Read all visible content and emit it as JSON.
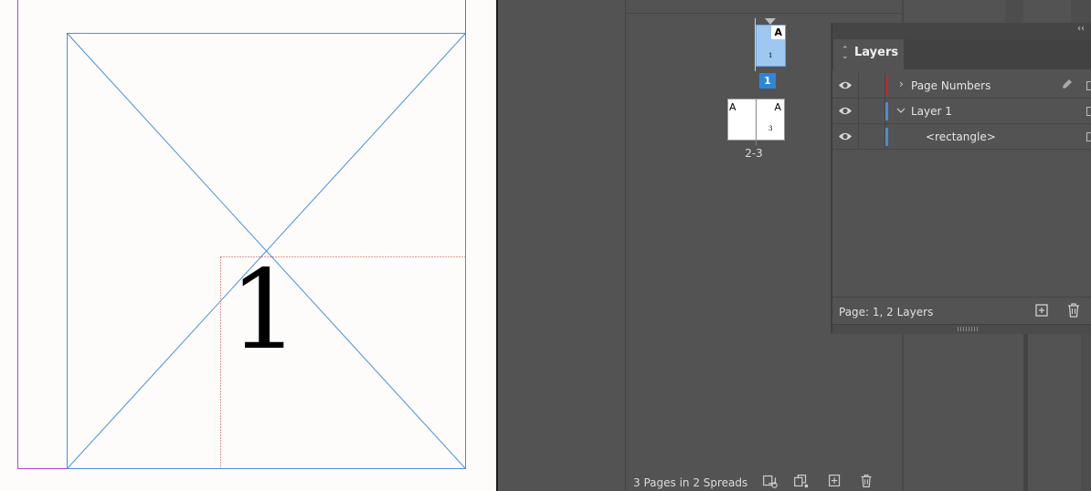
{
  "document": {
    "page_number_marker": "1"
  },
  "pages_panel": {
    "master_prefix": "A",
    "thumb_page_1": "1",
    "spread_1_label": "1",
    "spread_2_label": "2-3",
    "spread_2_left_prefix": "A",
    "spread_2_right_prefix": "A",
    "thumb_page_3": "3",
    "status_text": "3 Pages in 2 Spreads",
    "icons": [
      "edit-page-size-icon",
      "new-spread-icon",
      "create-new-page-icon",
      "delete-page-icon"
    ]
  },
  "layers_panel": {
    "collapse_glyph": "‹‹",
    "tab_label": "Layers",
    "rows": [
      {
        "name": "Page Numbers",
        "color": "#c1272d",
        "expanded": false,
        "has_pen": true
      },
      {
        "name": "Layer 1",
        "color": "#4a8bd6",
        "expanded": true,
        "has_pen": false
      },
      {
        "name": "<rectangle>",
        "color": "#4a8bd6",
        "child": true
      }
    ],
    "status_text": "Page: 1, 2 Layers",
    "icons": [
      "create-new-layer-icon",
      "delete-layer-icon"
    ]
  },
  "colors": {
    "selected_page_blue": "#9ec7f2",
    "page_badge_blue": "#2f86d8",
    "frame_blue": "#4a90d9",
    "margin_magenta": "#b544d6"
  }
}
